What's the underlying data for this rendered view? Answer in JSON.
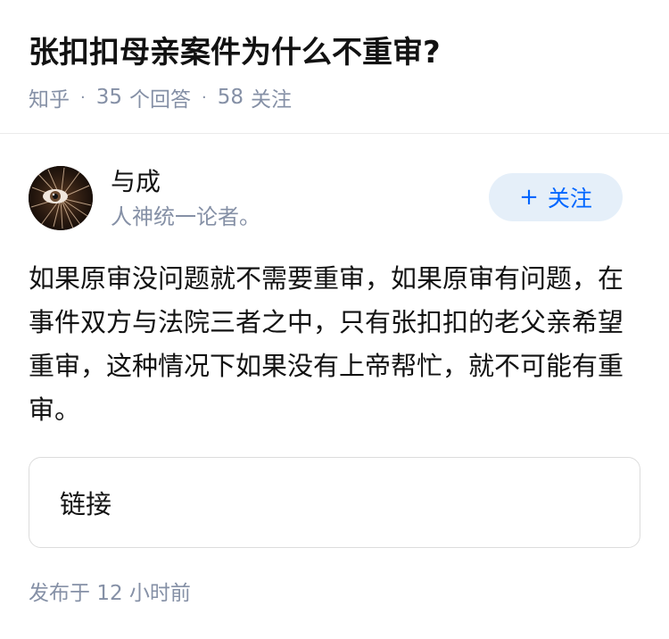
{
  "question": {
    "title": "张扣扣母亲案件为什么不重审?",
    "source": "知乎",
    "answer_count": "35",
    "answer_label": "个回答",
    "follower_count": "58",
    "follower_label": "关注",
    "separator": "·"
  },
  "author": {
    "name": "与成",
    "bio": "人神统一论者。",
    "follow_label": "关注",
    "follow_icon": "plus-icon",
    "avatar_icon": "eye-avatar"
  },
  "answer": {
    "content": "如果原审没问题就不需要重审，如果原审有问题，在事件双方与法院三者之中，只有张扣扣的老父亲希望重审，这种情况下如果没有上帝帮忙，就不可能有重审。",
    "link_card_label": "链接",
    "publish_prefix": "发布于",
    "publish_number": "12",
    "publish_unit": "小时前"
  },
  "colors": {
    "title": "#121212",
    "meta": "#8590a6",
    "accent": "#0066ff",
    "follow_bg": "#e5eff9",
    "divider": "#ebebeb"
  }
}
